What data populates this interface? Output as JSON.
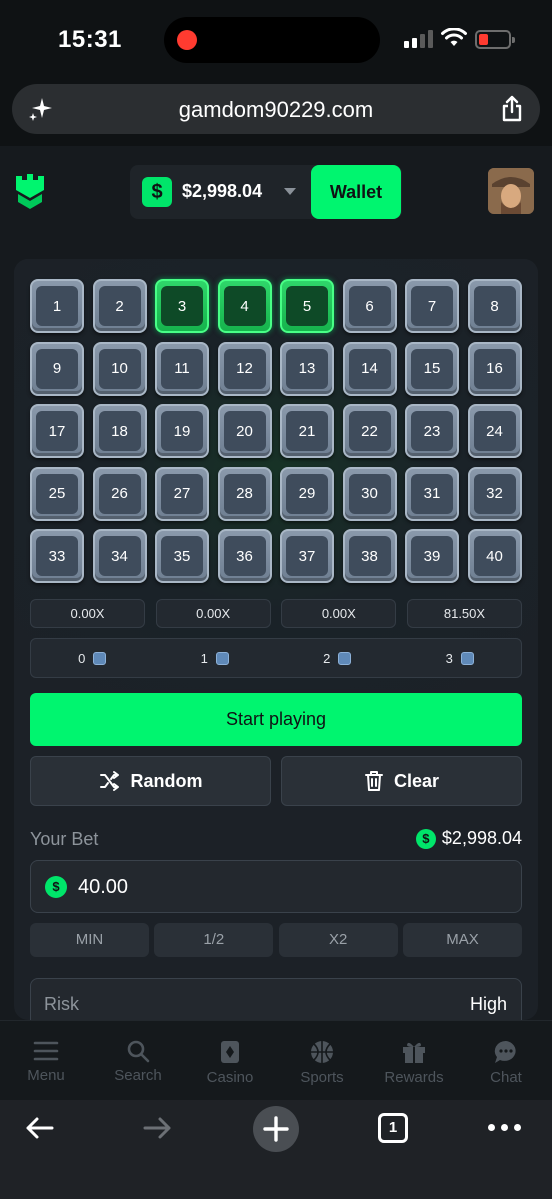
{
  "status": {
    "time": "15:31"
  },
  "browser": {
    "url": "gamdom90229.com"
  },
  "header": {
    "balance_currency_symbol": "$",
    "balance": "$2,998.04",
    "wallet_label": "Wallet"
  },
  "game": {
    "tiles": [
      "1",
      "2",
      "3",
      "4",
      "5",
      "6",
      "7",
      "8",
      "9",
      "10",
      "11",
      "12",
      "13",
      "14",
      "15",
      "16",
      "17",
      "18",
      "19",
      "20",
      "21",
      "22",
      "23",
      "24",
      "25",
      "26",
      "27",
      "28",
      "29",
      "30",
      "31",
      "32",
      "33",
      "34",
      "35",
      "36",
      "37",
      "38",
      "39",
      "40"
    ],
    "selected_tiles": [
      3,
      4,
      5
    ],
    "multipliers": [
      "0.00X",
      "0.00X",
      "0.00X",
      "81.50X"
    ],
    "hits": [
      "0",
      "1",
      "2",
      "3"
    ],
    "start_label": "Start playing",
    "random_label": "Random",
    "clear_label": "Clear"
  },
  "bet": {
    "label": "Your Bet",
    "balance": "$2,998.04",
    "currency_symbol": "$",
    "amount": "40.00",
    "quick": [
      "MIN",
      "1/2",
      "X2",
      "MAX"
    ]
  },
  "risk": {
    "label": "Risk",
    "value": "High"
  },
  "nav": {
    "items": [
      {
        "label": "Menu",
        "icon": "menu-icon"
      },
      {
        "label": "Search",
        "icon": "search-icon"
      },
      {
        "label": "Casino",
        "icon": "casino-icon"
      },
      {
        "label": "Sports",
        "icon": "sports-icon"
      },
      {
        "label": "Rewards",
        "icon": "gift-icon"
      },
      {
        "label": "Chat",
        "icon": "chat-icon"
      }
    ]
  },
  "browser_toolbar": {
    "tab_count": "1"
  },
  "colors": {
    "accent": "#00f56f",
    "panel": "#1c2127",
    "tile": "#3f4c5c"
  }
}
